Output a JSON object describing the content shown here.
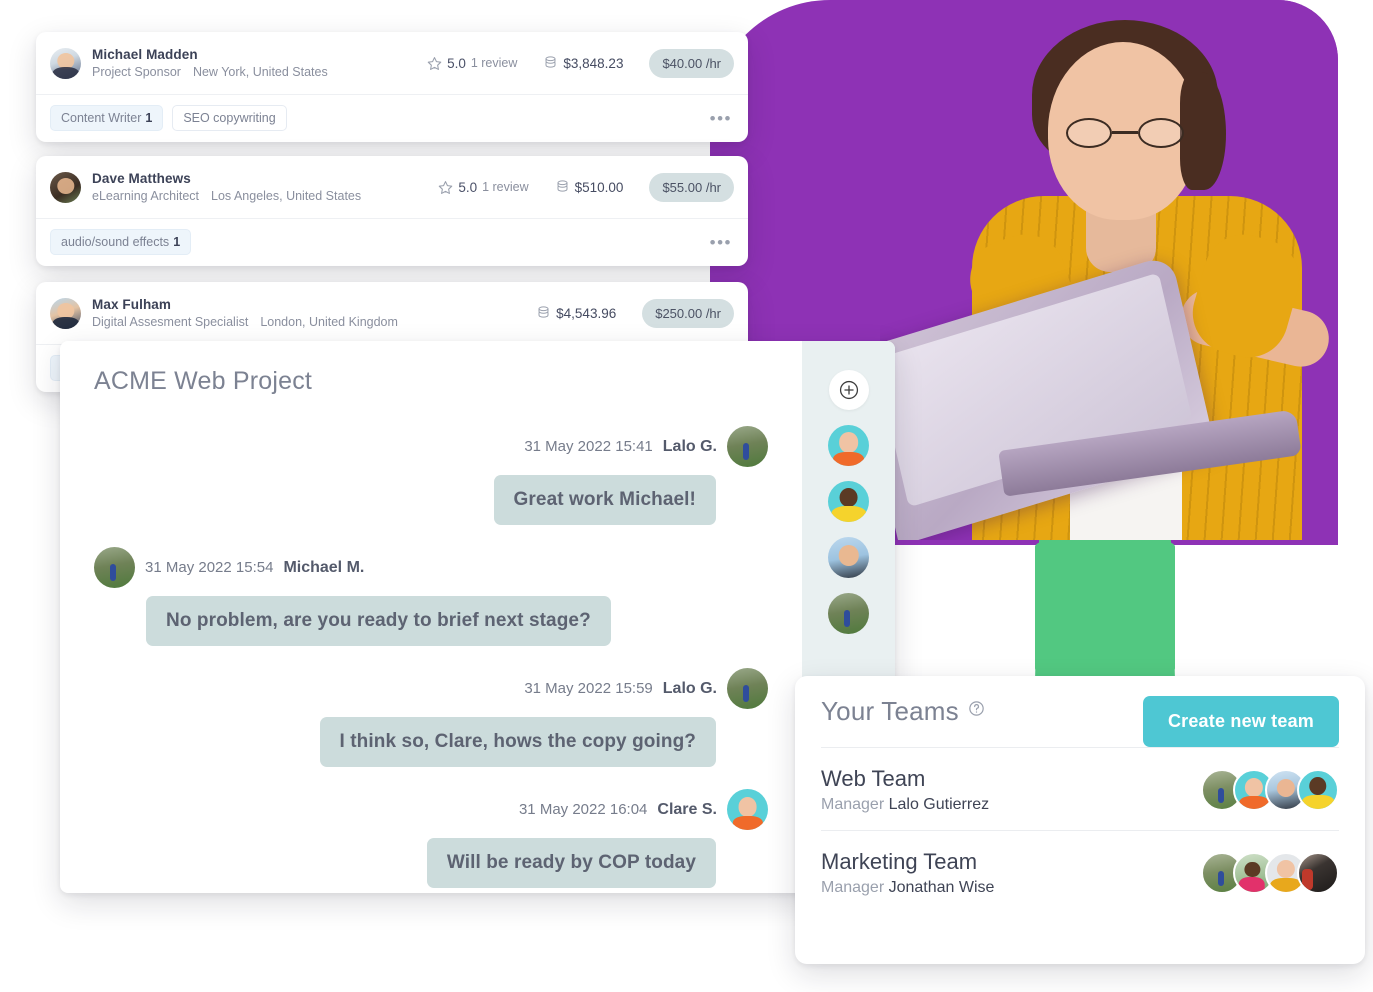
{
  "colors": {
    "purple": "#8E32B5",
    "green": "#52C881",
    "teal_accent": "#4EC7D3",
    "bubble": "#CCDCDC",
    "rate_pill": "#D4DFE1",
    "chat_sidebar": "#E9F0F1"
  },
  "freelancer_cards": [
    {
      "name": "Michael Madden",
      "role": "Project Sponsor",
      "location": "New York, United States",
      "rating": "5.0",
      "reviews": "1 review",
      "earned": "$3,848.23",
      "rate": "$40.00 /hr",
      "tags": [
        {
          "label": "Content Writer",
          "count": "1",
          "filled": true
        },
        {
          "label": "SEO copywriting",
          "count": "",
          "filled": false
        }
      ],
      "more_label": "•••"
    },
    {
      "name": "Dave Matthews",
      "role": "eLearning Architect",
      "location": "Los Angeles, United States",
      "rating": "5.0",
      "reviews": "1 review",
      "earned": "$510.00",
      "rate": "$55.00 /hr",
      "tags": [
        {
          "label": "audio/sound effects",
          "count": "1",
          "filled": true
        }
      ],
      "more_label": "•••"
    },
    {
      "name": "Max Fulham",
      "role": "Digital Assesment Specialist",
      "location": "London, United Kingdom",
      "rating": "",
      "reviews": "",
      "earned": "$4,543.96",
      "rate": "$250.00 /hr",
      "tags": [],
      "more_label": ""
    }
  ],
  "chat": {
    "title": "ACME Web Project",
    "messages": [
      {
        "side": "right",
        "time": "31 May 2022 15:41",
        "author": "Lalo G.",
        "text": "Great work Michael!",
        "avatar": "av-lalo"
      },
      {
        "side": "left",
        "time": "31 May 2022 15:54",
        "author": "Michael M.",
        "text": "No problem, are you ready to brief next stage?",
        "avatar": "av-lalo"
      },
      {
        "side": "right",
        "time": "31 May 2022 15:59",
        "author": "Lalo G.",
        "text": "I think so, Clare, hows the copy going?",
        "avatar": "av-lalo"
      },
      {
        "side": "right",
        "time": "31 May 2022 16:04",
        "author": "Clare S.",
        "text": "Will be ready by COP today",
        "avatar": "av-clare"
      }
    ],
    "sidebar": {
      "add_icon": "plus-icon",
      "members": [
        "av-gm",
        "av-yellow",
        "av-blue",
        "av-lalo"
      ]
    }
  },
  "teams": {
    "title": "Your Teams",
    "help_icon": "question-mark-circle-icon",
    "create_button": "Create new team",
    "manager_label": "Manager",
    "rows": [
      {
        "name": "Web Team",
        "manager": "Lalo Gutierrez",
        "avatars": [
          "av-field",
          "av-gm",
          "av-man2",
          "av-yellow"
        ]
      },
      {
        "name": "Marketing Team",
        "manager": "Jonathan Wise",
        "avatars": [
          "av-field",
          "av-pink",
          "av-grey",
          "av-suit"
        ]
      }
    ]
  }
}
